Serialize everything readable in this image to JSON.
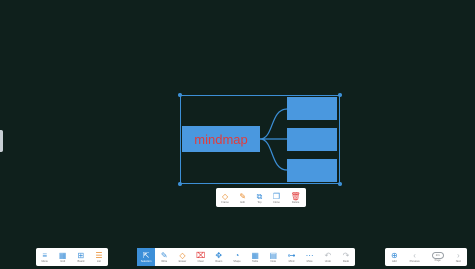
{
  "canvas": {
    "background": "#0f201c",
    "mindmap": {
      "root_label": "mindmap",
      "root_color": "#4a98df",
      "root_text_color": "#e23c3c",
      "selection_color": "#3d8fd6"
    }
  },
  "context_toolbar": {
    "items": [
      {
        "label": "Frame",
        "icon": "frame-icon",
        "color": "#e88a2a",
        "glyph": "◇"
      },
      {
        "label": "Edit",
        "icon": "edit-pen-icon",
        "color": "#e88a2a",
        "glyph": "✎"
      },
      {
        "label": "Top",
        "icon": "layer-top-icon",
        "color": "#3c8fd8",
        "glyph": "⧉"
      },
      {
        "label": "Clone",
        "icon": "clone-icon",
        "color": "#3c8fd8",
        "glyph": "❐"
      },
      {
        "label": "Delete",
        "icon": "delete-icon",
        "color": "#e23c3c",
        "glyph": "🗑"
      }
    ]
  },
  "bottom_left": {
    "items": [
      {
        "label": "Menu",
        "icon": "menu-icon",
        "glyph": "≡"
      },
      {
        "label": "Grid",
        "icon": "grid-icon",
        "glyph": "▦"
      },
      {
        "label": "Board",
        "icon": "board-icon",
        "glyph": "⊞"
      },
      {
        "label": "List",
        "icon": "list-icon",
        "glyph": "☰"
      }
    ]
  },
  "bottom_center": {
    "items": [
      {
        "label": "Selection",
        "icon": "cursor-icon",
        "glyph": "⇱",
        "active": true
      },
      {
        "label": "Write",
        "icon": "pen-icon",
        "glyph": "✎"
      },
      {
        "label": "Eraser",
        "icon": "eraser-icon",
        "glyph": "◇"
      },
      {
        "label": "Clear",
        "icon": "clear-icon",
        "glyph": "⌧"
      },
      {
        "label": "Roam",
        "icon": "roam-icon",
        "glyph": "✥"
      },
      {
        "label": "Shape",
        "icon": "shape-icon",
        "glyph": "◔"
      },
      {
        "label": "Table",
        "icon": "table-icon",
        "glyph": "▦"
      },
      {
        "label": "Note",
        "icon": "note-icon",
        "glyph": "▤"
      },
      {
        "label": "Mind",
        "icon": "mindmap-icon",
        "glyph": "⊶"
      },
      {
        "label": "More",
        "icon": "more-icon",
        "glyph": "⋯"
      },
      {
        "label": "Undo",
        "icon": "undo-icon",
        "glyph": "↶"
      },
      {
        "label": "Redo",
        "icon": "redo-icon",
        "glyph": "↷"
      }
    ]
  },
  "bottom_right": {
    "items": [
      {
        "label": "Add",
        "icon": "add-page-icon",
        "glyph": "⊕"
      },
      {
        "label": "Previous",
        "icon": "previous-icon",
        "glyph": "‹"
      },
      {
        "label": "Next",
        "icon": "next-icon",
        "glyph": "›"
      }
    ],
    "page_indicator": "1/1",
    "page_label": "Page"
  }
}
